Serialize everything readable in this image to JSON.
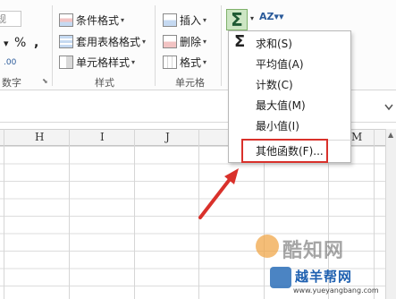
{
  "ribbon": {
    "number": {
      "percent": "%",
      "comma": ",",
      "decimal_icon_text": ".00",
      "group_label": "数字",
      "format_top_fragment": "规"
    },
    "styles": {
      "conditional_format": "条件格式",
      "table_format": "套用表格格式",
      "cell_style": "单元格样式",
      "group_label": "样式"
    },
    "cells": {
      "insert": "插入",
      "delete": "删除",
      "format": "格式",
      "group_label": "单元格"
    },
    "editing": {
      "autosum_symbol": "Σ",
      "sort_icon_text": "AZ"
    }
  },
  "autosum_menu": {
    "items": [
      {
        "label": "求和(S)"
      },
      {
        "label": "平均值(A)"
      },
      {
        "label": "计数(C)"
      },
      {
        "label": "最大值(M)"
      },
      {
        "label": "最小值(I)"
      },
      {
        "label": "其他函数(F)..."
      }
    ],
    "sigma": "Σ"
  },
  "sheet": {
    "columns": [
      "H",
      "I",
      "J",
      "M"
    ]
  },
  "watermarks": {
    "site1": "酷知网",
    "site2": "越羊帮网",
    "site2_url": "www.yueyangbang.com"
  },
  "colors": {
    "highlight": "#d9312b",
    "arrow": "#d9312b",
    "autosum_bg": "#cde6c4"
  }
}
